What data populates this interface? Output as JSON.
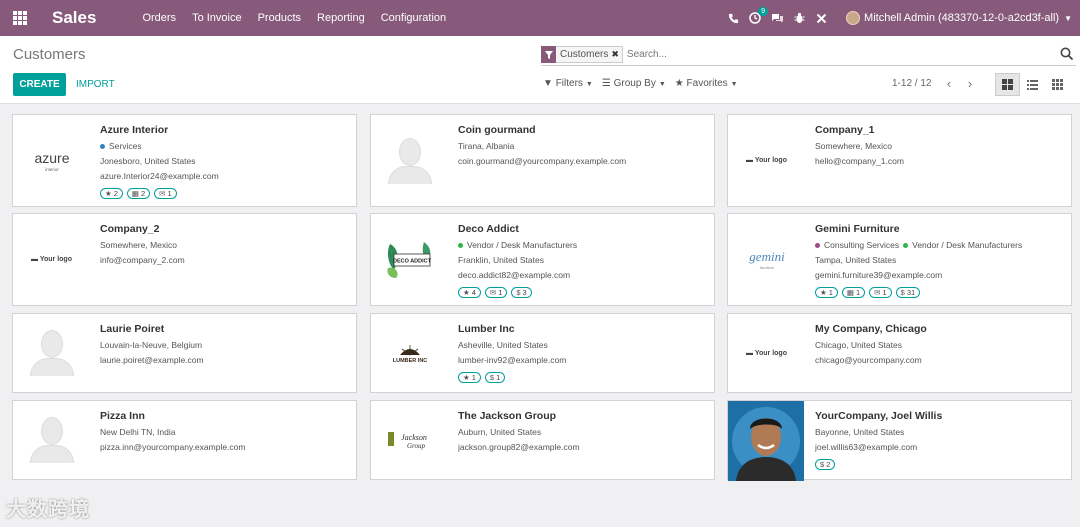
{
  "app": {
    "brand": "Sales",
    "menu": [
      "Orders",
      "To Invoice",
      "Products",
      "Reporting",
      "Configuration"
    ],
    "activity_badge": "9",
    "user": "Mitchell Admin (483370-12-0-a2cd3f-all)"
  },
  "control": {
    "title": "Customers",
    "search_facet": "Customers",
    "search_placeholder": "Search...",
    "create_label": "CREATE",
    "import_label": "IMPORT",
    "filters_label": "Filters",
    "groupby_label": "Group By",
    "favorites_label": "Favorites",
    "pager": "1-12 / 12"
  },
  "colors": {
    "topbar": "#875a7b",
    "primary": "#00a09d"
  },
  "customers": [
    {
      "name": "Azure Interior",
      "tags": [
        {
          "label": "Services",
          "color": "#2f84c5"
        }
      ],
      "location": "Jonesboro, United States",
      "email": "azure.Interior24@example.com",
      "logo": "azure interior",
      "chips": [
        {
          "icon": "★",
          "value": "2"
        },
        {
          "icon": "▦",
          "value": "2"
        },
        {
          "icon": "✉",
          "value": "1"
        }
      ]
    },
    {
      "name": "Coin gourmand",
      "tags": [],
      "location": "Tirana, Albania",
      "email": "coin.gourmand@yourcompany.example.com",
      "logo": "placeholder",
      "chips": []
    },
    {
      "name": "Company_1",
      "tags": [],
      "location": "Somewhere, Mexico",
      "email": "hello@company_1.com",
      "logo": "Your logo",
      "chips": []
    },
    {
      "name": "Company_2",
      "tags": [],
      "location": "Somewhere, Mexico",
      "email": "info@company_2.com",
      "logo": "Your logo",
      "chips": []
    },
    {
      "name": "Deco Addict",
      "tags": [
        {
          "label": "Vendor / Desk Manufacturers",
          "color": "#30b54a"
        }
      ],
      "location": "Franklin, United States",
      "email": "deco.addict82@example.com",
      "logo": "DECO ADDICT",
      "chips": [
        {
          "icon": "★",
          "value": "4"
        },
        {
          "icon": "✉",
          "value": "1"
        },
        {
          "icon": "$",
          "value": "3"
        }
      ]
    },
    {
      "name": "Gemini Furniture",
      "tags": [
        {
          "label": "Consulting Services",
          "color": "#a24689"
        },
        {
          "label": "Vendor / Desk Manufacturers",
          "color": "#30b54a"
        }
      ],
      "location": "Tampa, United States",
      "email": "gemini.furniture39@example.com",
      "logo": "gemini",
      "chips": [
        {
          "icon": "★",
          "value": "1"
        },
        {
          "icon": "▦",
          "value": "1"
        },
        {
          "icon": "✉",
          "value": "1"
        },
        {
          "icon": "$",
          "value": "31"
        }
      ]
    },
    {
      "name": "Laurie Poiret",
      "tags": [],
      "location": "Louvain-la-Neuve, Belgium",
      "email": "laurie.poiret@example.com",
      "logo": "placeholder",
      "chips": []
    },
    {
      "name": "Lumber Inc",
      "tags": [],
      "location": "Asheville, United States",
      "email": "lumber-inv92@example.com",
      "logo": "LUMBER INC",
      "chips": [
        {
          "icon": "★",
          "value": "1"
        },
        {
          "icon": "$",
          "value": "1"
        }
      ]
    },
    {
      "name": "My Company, Chicago",
      "tags": [],
      "location": "Chicago, United States",
      "email": "chicago@yourcompany.com",
      "logo": "Your logo",
      "chips": []
    },
    {
      "name": "Pizza Inn",
      "tags": [],
      "location": "New Delhi TN, India",
      "email": "pizza.inn@yourcompany.example.com",
      "logo": "placeholder",
      "chips": []
    },
    {
      "name": "The Jackson Group",
      "tags": [],
      "location": "Auburn, United States",
      "email": "jackson.group82@example.com",
      "logo": "Jackson Group",
      "chips": []
    },
    {
      "name": "YourCompany, Joel Willis",
      "tags": [],
      "location": "Bayonne, United States",
      "email": "joel.willis63@example.com",
      "logo": "photo",
      "chips": [
        {
          "icon": "$",
          "value": "2"
        }
      ]
    }
  ],
  "watermark": "大数跨境"
}
